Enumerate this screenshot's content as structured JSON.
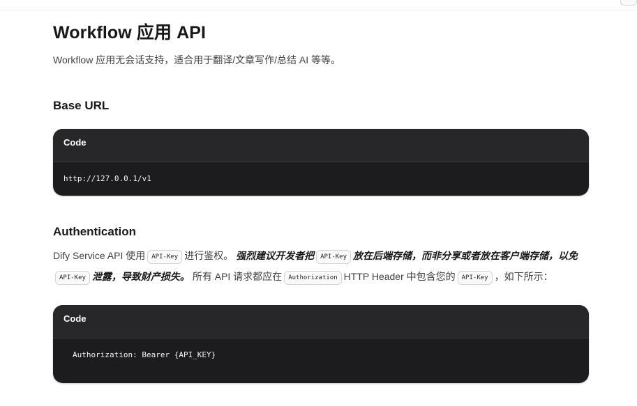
{
  "page": {
    "title": "Workflow 应用 API",
    "subtitle": "Workflow 应用无会话支持，适合用于翻译/文章写作/总结 AI 等等。"
  },
  "base_url": {
    "heading": "Base URL",
    "code_label": "Code",
    "code": "http://127.0.0.1/v1"
  },
  "auth": {
    "heading": "Authentication",
    "p1": "Dify Service API 使用",
    "chip_api_key": "API-Key",
    "p2": "进行鉴权。",
    "strong1": "强烈建议开发者把",
    "strong2": "放在后端存储，而非分享或者放在客户端存储，以免",
    "strong3": "泄露，导致财产损失。",
    "p3": "所有 API 请求都应在",
    "chip_authorization": "Authorization",
    "p4": "HTTP Header 中包含您的",
    "p5": "，如下所示：",
    "code_label": "Code",
    "code": "Authorization: Bearer {API_KEY}"
  }
}
